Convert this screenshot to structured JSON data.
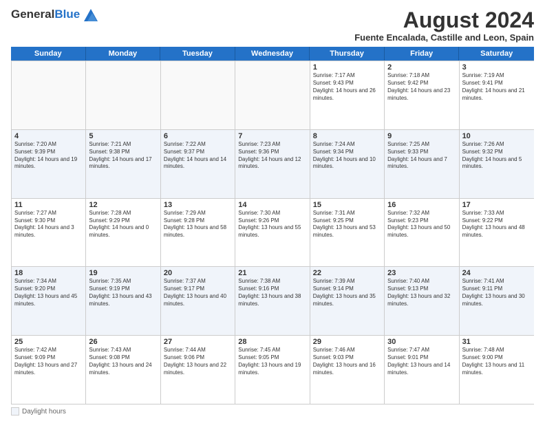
{
  "logo": {
    "general": "General",
    "blue": "Blue"
  },
  "title": {
    "month_year": "August 2024",
    "location": "Fuente Encalada, Castille and Leon, Spain"
  },
  "header_days": [
    "Sunday",
    "Monday",
    "Tuesday",
    "Wednesday",
    "Thursday",
    "Friday",
    "Saturday"
  ],
  "footer": {
    "legend_label": "Daylight hours"
  },
  "weeks": [
    [
      {
        "day": "",
        "text": ""
      },
      {
        "day": "",
        "text": ""
      },
      {
        "day": "",
        "text": ""
      },
      {
        "day": "",
        "text": ""
      },
      {
        "day": "1",
        "text": "Sunrise: 7:17 AM\nSunset: 9:43 PM\nDaylight: 14 hours and 26 minutes."
      },
      {
        "day": "2",
        "text": "Sunrise: 7:18 AM\nSunset: 9:42 PM\nDaylight: 14 hours and 23 minutes."
      },
      {
        "day": "3",
        "text": "Sunrise: 7:19 AM\nSunset: 9:41 PM\nDaylight: 14 hours and 21 minutes."
      }
    ],
    [
      {
        "day": "4",
        "text": "Sunrise: 7:20 AM\nSunset: 9:39 PM\nDaylight: 14 hours and 19 minutes."
      },
      {
        "day": "5",
        "text": "Sunrise: 7:21 AM\nSunset: 9:38 PM\nDaylight: 14 hours and 17 minutes."
      },
      {
        "day": "6",
        "text": "Sunrise: 7:22 AM\nSunset: 9:37 PM\nDaylight: 14 hours and 14 minutes."
      },
      {
        "day": "7",
        "text": "Sunrise: 7:23 AM\nSunset: 9:36 PM\nDaylight: 14 hours and 12 minutes."
      },
      {
        "day": "8",
        "text": "Sunrise: 7:24 AM\nSunset: 9:34 PM\nDaylight: 14 hours and 10 minutes."
      },
      {
        "day": "9",
        "text": "Sunrise: 7:25 AM\nSunset: 9:33 PM\nDaylight: 14 hours and 7 minutes."
      },
      {
        "day": "10",
        "text": "Sunrise: 7:26 AM\nSunset: 9:32 PM\nDaylight: 14 hours and 5 minutes."
      }
    ],
    [
      {
        "day": "11",
        "text": "Sunrise: 7:27 AM\nSunset: 9:30 PM\nDaylight: 14 hours and 3 minutes."
      },
      {
        "day": "12",
        "text": "Sunrise: 7:28 AM\nSunset: 9:29 PM\nDaylight: 14 hours and 0 minutes."
      },
      {
        "day": "13",
        "text": "Sunrise: 7:29 AM\nSunset: 9:28 PM\nDaylight: 13 hours and 58 minutes."
      },
      {
        "day": "14",
        "text": "Sunrise: 7:30 AM\nSunset: 9:26 PM\nDaylight: 13 hours and 55 minutes."
      },
      {
        "day": "15",
        "text": "Sunrise: 7:31 AM\nSunset: 9:25 PM\nDaylight: 13 hours and 53 minutes."
      },
      {
        "day": "16",
        "text": "Sunrise: 7:32 AM\nSunset: 9:23 PM\nDaylight: 13 hours and 50 minutes."
      },
      {
        "day": "17",
        "text": "Sunrise: 7:33 AM\nSunset: 9:22 PM\nDaylight: 13 hours and 48 minutes."
      }
    ],
    [
      {
        "day": "18",
        "text": "Sunrise: 7:34 AM\nSunset: 9:20 PM\nDaylight: 13 hours and 45 minutes."
      },
      {
        "day": "19",
        "text": "Sunrise: 7:35 AM\nSunset: 9:19 PM\nDaylight: 13 hours and 43 minutes."
      },
      {
        "day": "20",
        "text": "Sunrise: 7:37 AM\nSunset: 9:17 PM\nDaylight: 13 hours and 40 minutes."
      },
      {
        "day": "21",
        "text": "Sunrise: 7:38 AM\nSunset: 9:16 PM\nDaylight: 13 hours and 38 minutes."
      },
      {
        "day": "22",
        "text": "Sunrise: 7:39 AM\nSunset: 9:14 PM\nDaylight: 13 hours and 35 minutes."
      },
      {
        "day": "23",
        "text": "Sunrise: 7:40 AM\nSunset: 9:13 PM\nDaylight: 13 hours and 32 minutes."
      },
      {
        "day": "24",
        "text": "Sunrise: 7:41 AM\nSunset: 9:11 PM\nDaylight: 13 hours and 30 minutes."
      }
    ],
    [
      {
        "day": "25",
        "text": "Sunrise: 7:42 AM\nSunset: 9:09 PM\nDaylight: 13 hours and 27 minutes."
      },
      {
        "day": "26",
        "text": "Sunrise: 7:43 AM\nSunset: 9:08 PM\nDaylight: 13 hours and 24 minutes."
      },
      {
        "day": "27",
        "text": "Sunrise: 7:44 AM\nSunset: 9:06 PM\nDaylight: 13 hours and 22 minutes."
      },
      {
        "day": "28",
        "text": "Sunrise: 7:45 AM\nSunset: 9:05 PM\nDaylight: 13 hours and 19 minutes."
      },
      {
        "day": "29",
        "text": "Sunrise: 7:46 AM\nSunset: 9:03 PM\nDaylight: 13 hours and 16 minutes."
      },
      {
        "day": "30",
        "text": "Sunrise: 7:47 AM\nSunset: 9:01 PM\nDaylight: 13 hours and 14 minutes."
      },
      {
        "day": "31",
        "text": "Sunrise: 7:48 AM\nSunset: 9:00 PM\nDaylight: 13 hours and 11 minutes."
      }
    ]
  ]
}
